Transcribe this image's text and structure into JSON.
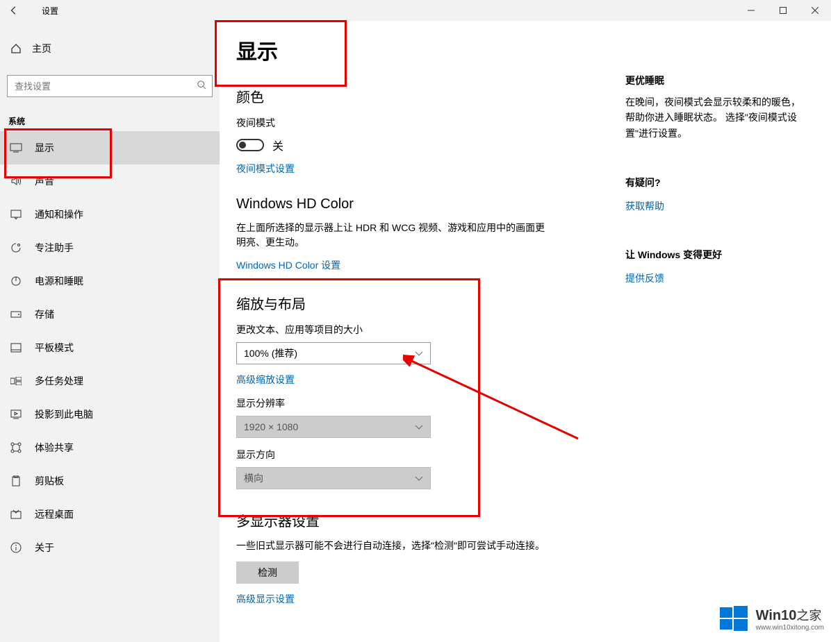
{
  "titlebar": {
    "title": "设置"
  },
  "sidebar": {
    "home_label": "主页",
    "search_placeholder": "查找设置",
    "section_label": "系统",
    "items": [
      {
        "label": "显示"
      },
      {
        "label": "声音"
      },
      {
        "label": "通知和操作"
      },
      {
        "label": "专注助手"
      },
      {
        "label": "电源和睡眠"
      },
      {
        "label": "存储"
      },
      {
        "label": "平板模式"
      },
      {
        "label": "多任务处理"
      },
      {
        "label": "投影到此电脑"
      },
      {
        "label": "体验共享"
      },
      {
        "label": "剪贴板"
      },
      {
        "label": "远程桌面"
      },
      {
        "label": "关于"
      }
    ]
  },
  "main": {
    "page_title": "显示",
    "color_heading": "颜色",
    "night_label": "夜间模式",
    "night_state": "关",
    "night_link": "夜间模式设置",
    "hd_heading": "Windows HD Color",
    "hd_desc": "在上面所选择的显示器上让 HDR 和 WCG 视频、游戏和应用中的画面更明亮、更生动。",
    "hd_link": "Windows HD Color 设置",
    "scale_heading": "缩放与布局",
    "scale_label": "更改文本、应用等项目的大小",
    "scale_value": "100% (推荐)",
    "scale_link": "高级缩放设置",
    "res_label": "显示分辨率",
    "res_value": "1920 × 1080",
    "orient_label": "显示方向",
    "orient_value": "横向",
    "multi_heading": "多显示器设置",
    "multi_desc": "一些旧式显示器可能不会进行自动连接，选择\"检测\"即可尝试手动连接。",
    "detect_label": "检测",
    "adv_link": "高级显示设置"
  },
  "right": {
    "sleep_heading": "更优睡眠",
    "sleep_desc": "在晚间，夜间模式会显示较柔和的暖色，帮助你进入睡眠状态。 选择\"夜间模式设置\"进行设置。",
    "help_heading": "有疑问?",
    "help_link": "获取帮助",
    "better_heading": "让 Windows 变得更好",
    "feedback_link": "提供反馈"
  },
  "watermark": {
    "brand": "Win10",
    "suffix": "之家",
    "url": "www.win10xitong.com"
  }
}
